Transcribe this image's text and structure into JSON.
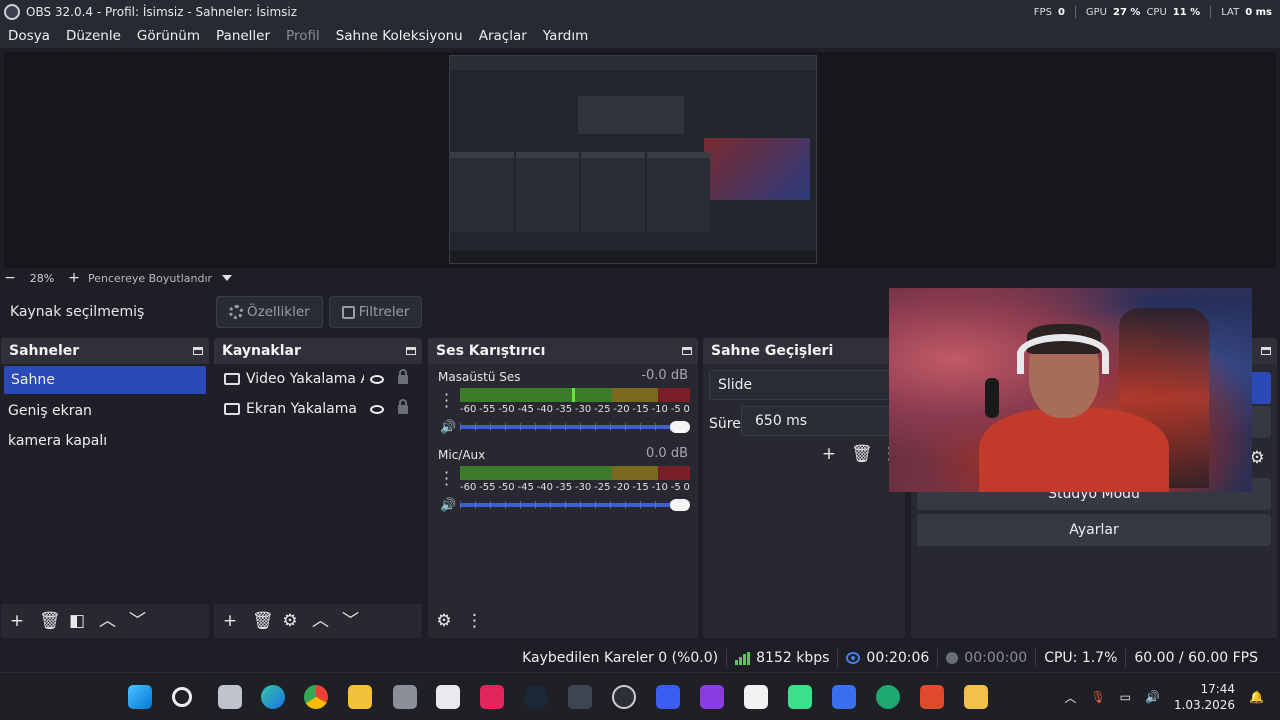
{
  "window": {
    "title": "OBS 32.0.4 - Profil: İsimsiz - Sahneler: İsimsiz",
    "perf": {
      "fps_label": "FPS",
      "fps_value": "0",
      "gpu_label": "GPU",
      "gpu_value": "27 %",
      "cpu_label": "CPU",
      "cpu_value": "11 %",
      "lat_label": "LAT",
      "lat_value": "0 ms"
    }
  },
  "menu": [
    "Dosya",
    "Düzenle",
    "Görünüm",
    "Paneller",
    "Profil",
    "Sahne Koleksiyonu",
    "Araçlar",
    "Yardım"
  ],
  "zoom": {
    "minus": "−",
    "value": "28%",
    "plus": "+",
    "fit_label": "Pencereye Boyutlandır"
  },
  "context": {
    "no_source": "Kaynak seçilmemiş",
    "properties": "Özellikler",
    "filters": "Filtreler"
  },
  "scenes": {
    "title": "Sahneler",
    "items": [
      "Sahne",
      "Geniş ekran",
      "kamera kapalı"
    ],
    "selected_index": 0
  },
  "sources": {
    "title": "Kaynaklar",
    "items": [
      {
        "name": "Video Yakalama Aygıtı",
        "icon": "camera-icon"
      },
      {
        "name": "Ekran Yakalama",
        "icon": "monitor-icon"
      }
    ]
  },
  "mixer": {
    "title": "Ses Karıştırıcı",
    "channels": [
      {
        "name": "Masaüstü Ses",
        "db": "-0.0 dB",
        "level": 0.42
      },
      {
        "name": "Mic/Aux",
        "db": "0.0 dB",
        "level": 0.0
      }
    ],
    "scale": [
      "-60",
      "-55",
      "-50",
      "-45",
      "-40",
      "-35",
      "-30",
      "-25",
      "-20",
      "-15",
      "-10",
      "-5",
      "0"
    ]
  },
  "transitions": {
    "title": "Sahne Geçişleri",
    "selected": "Slide",
    "duration_label": "Süre",
    "duration_value": "650 ms"
  },
  "controls": {
    "studio_mode": "Stüdyo Modu",
    "settings": "Ayarlar"
  },
  "status": {
    "dropped": "Kaybedilen Kareler 0 (%0.0)",
    "bitrate": "8152 kbps",
    "live_time": "00:20:06",
    "rec_time": "00:00:00",
    "cpu": "CPU: 1.7%",
    "fps": "60.00 / 60.00 FPS"
  },
  "taskbar": {
    "time": "17:44",
    "date": "1.03.2026"
  },
  "colors": {
    "accent": "#2b4ab8",
    "background": "#1e1f26",
    "panel": "#272830",
    "meter_green": "#3d7a2b",
    "meter_yellow": "#7a6a1f",
    "meter_red": "#7a1f2a",
    "status_green": "#4fd04a"
  }
}
